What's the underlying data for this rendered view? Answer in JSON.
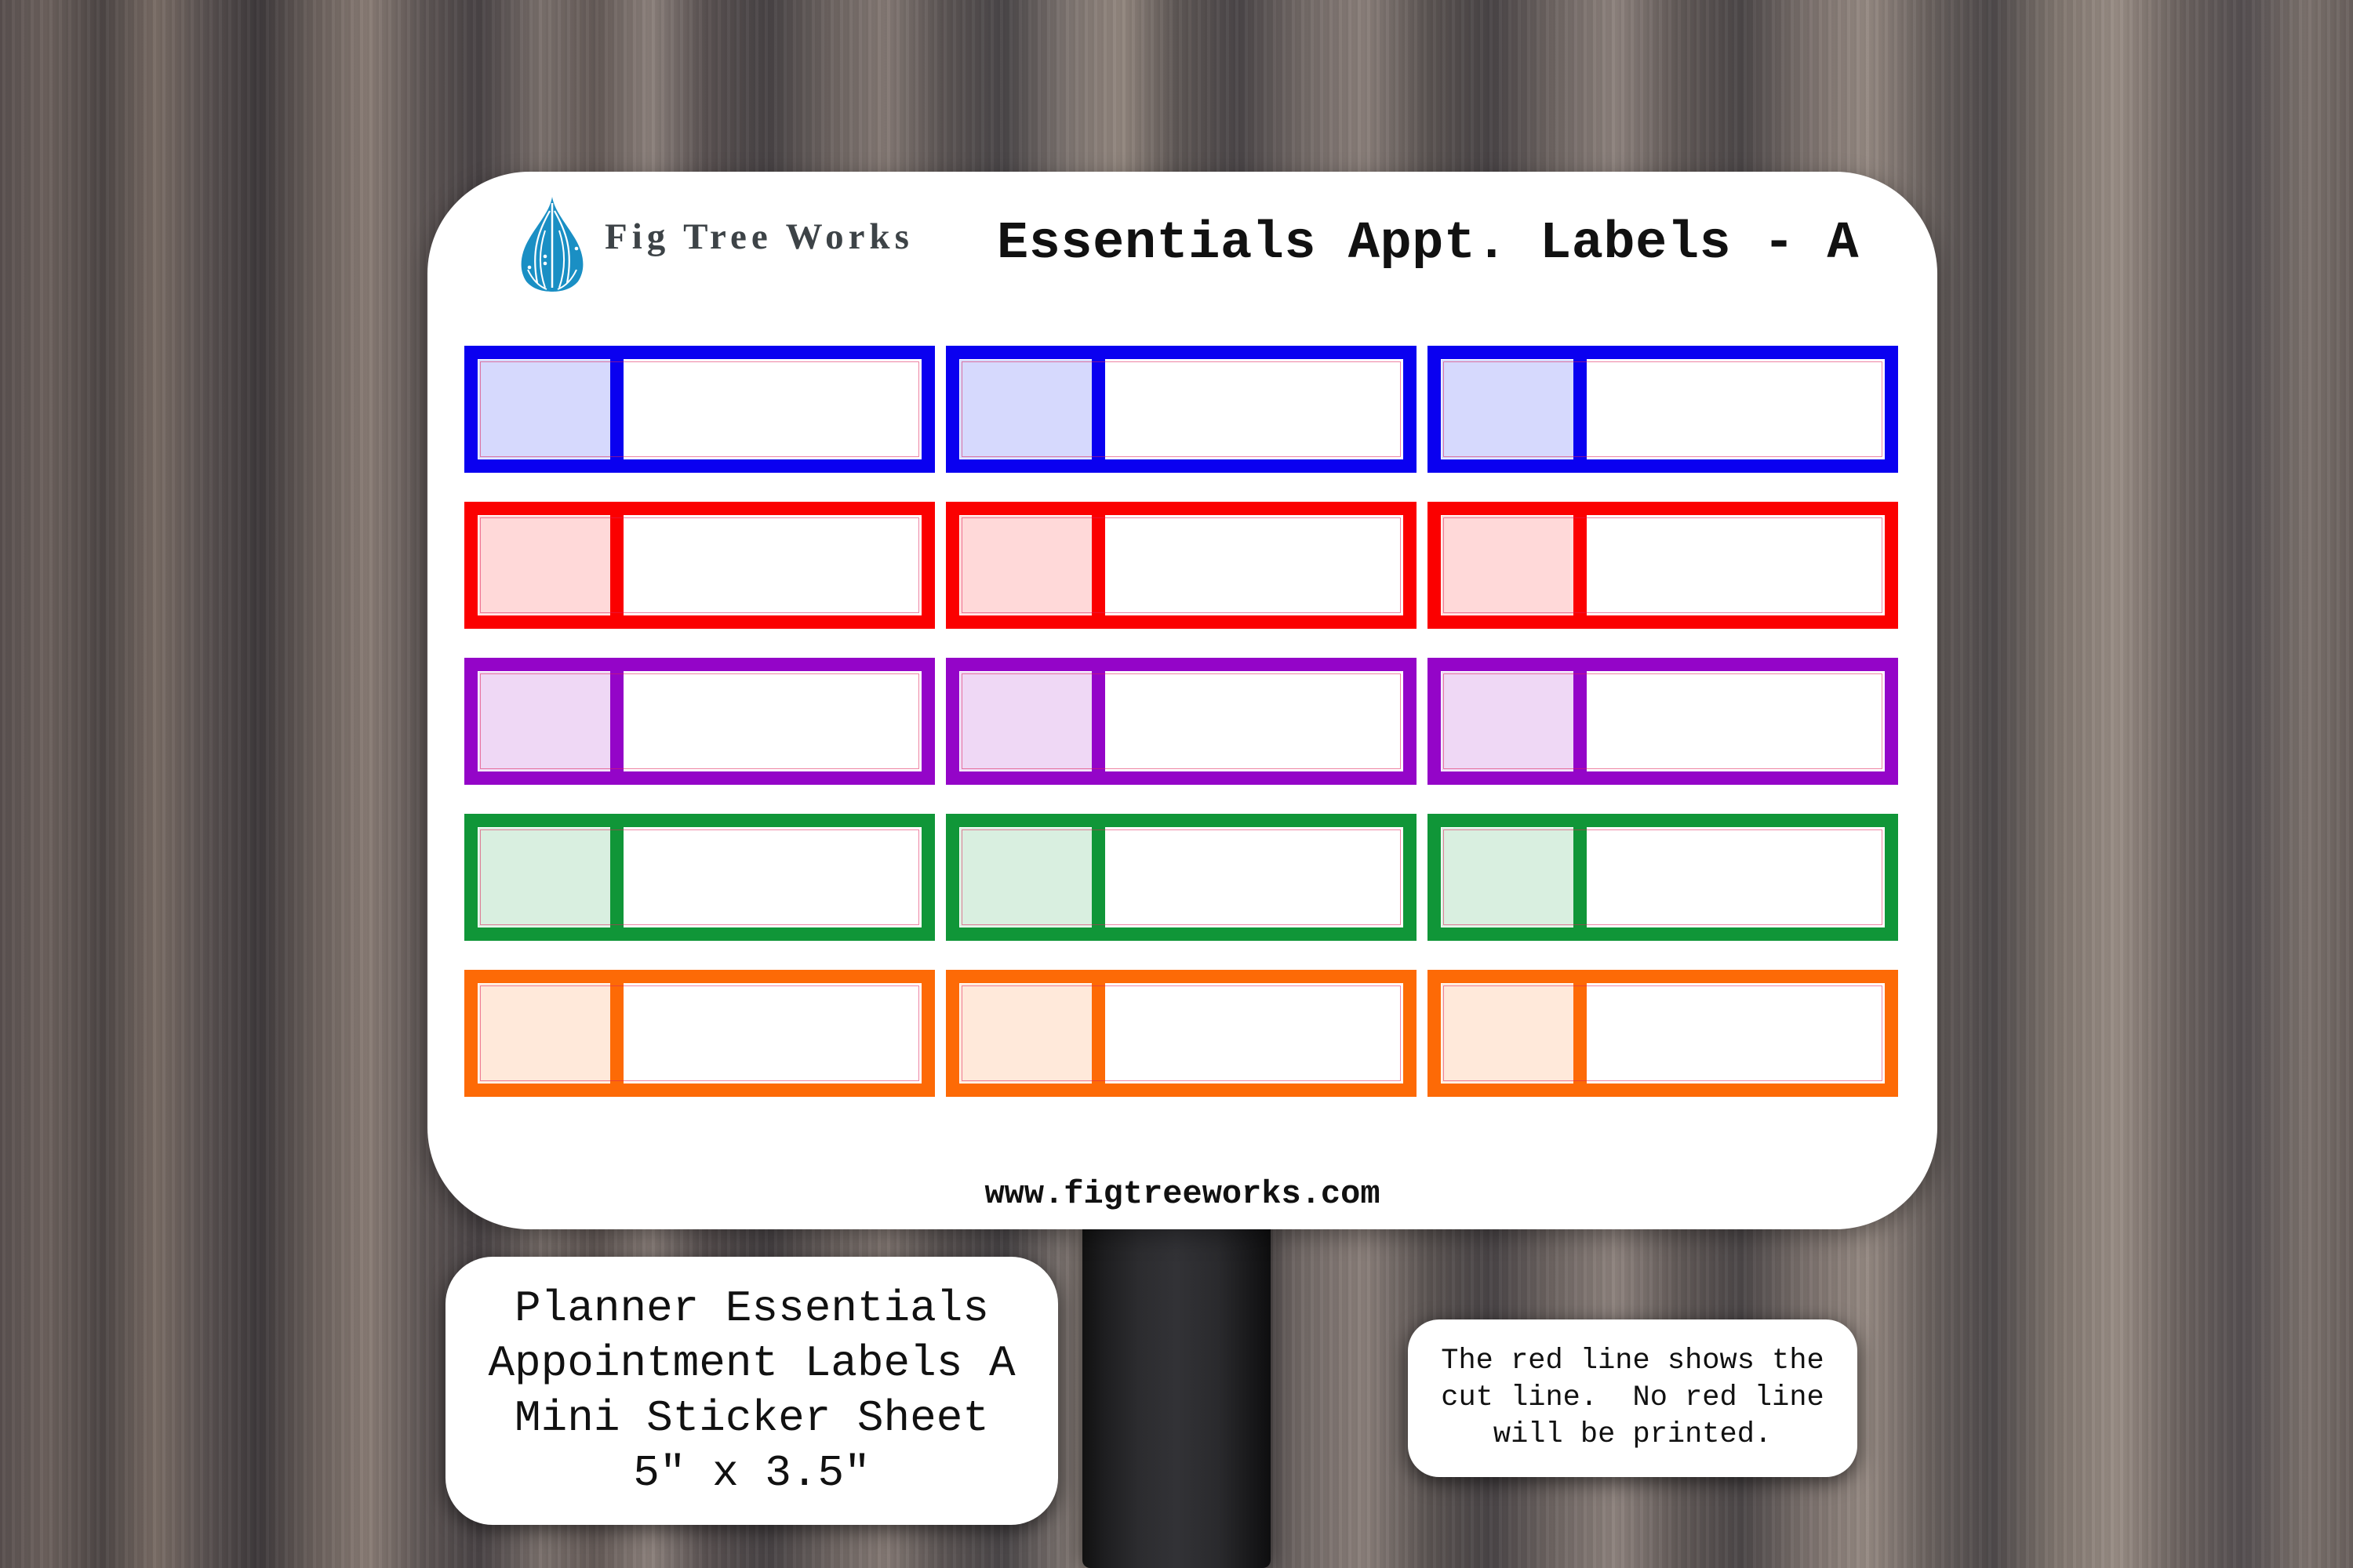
{
  "brand": {
    "name": "Fig Tree Works",
    "logo_icon": "fig-drop-icon",
    "logo_color": "#1a8fc4"
  },
  "sheet": {
    "title": "Essentials Appt. Labels - A",
    "website": "www.figtreeworks.com",
    "grid": {
      "rows": 5,
      "columns": 3
    },
    "rows": [
      {
        "name": "blue",
        "border": "#0a00f0",
        "fill": "#d6d9fd"
      },
      {
        "name": "red",
        "border": "#fb0000",
        "fill": "#ffd9d9"
      },
      {
        "name": "purple",
        "border": "#9405c8",
        "fill": "#efd8f5"
      },
      {
        "name": "green",
        "border": "#109638",
        "fill": "#d9efe0"
      },
      {
        "name": "orange",
        "border": "#fd6a06",
        "fill": "#ffe9da"
      }
    ],
    "cut_line_color": "#e0205a"
  },
  "product_info": {
    "lines": [
      "Planner Essentials",
      "Appointment Labels A",
      "Mini Sticker Sheet",
      "5\" x 3.5\""
    ]
  },
  "note": {
    "lines": [
      "The red line shows the",
      "cut line.  No red line",
      "will be printed."
    ]
  }
}
